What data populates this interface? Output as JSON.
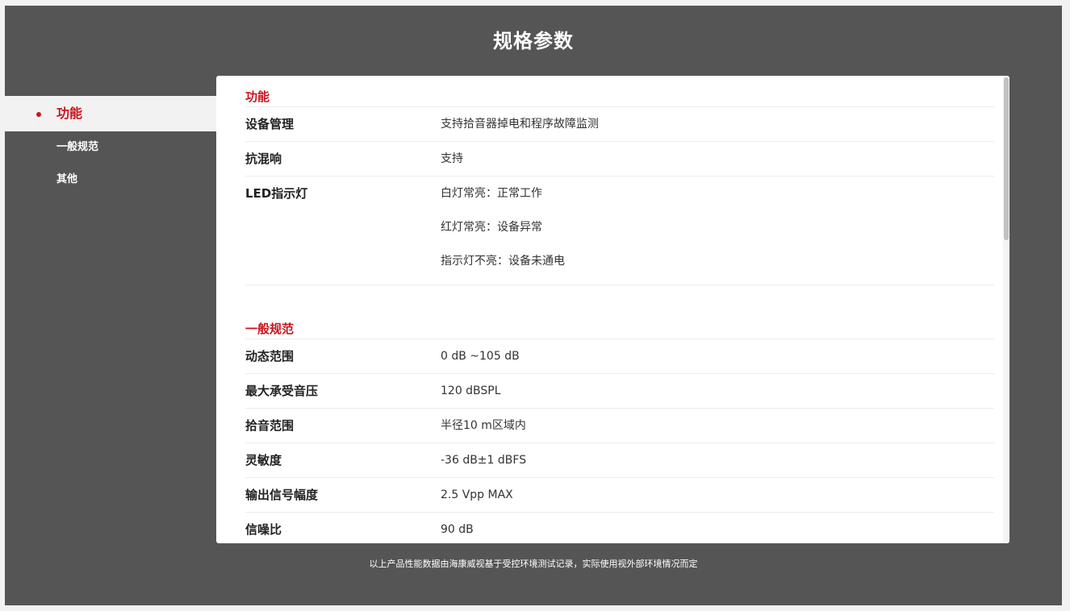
{
  "page_title": "规格参数",
  "sidebar": {
    "items": [
      {
        "label": "功能"
      },
      {
        "label": "一般规范"
      },
      {
        "label": "其他"
      }
    ]
  },
  "sections": [
    {
      "title": "功能",
      "rows": [
        {
          "key": "设备管理",
          "values": [
            "支持拾音器掉电和程序故障监测"
          ]
        },
        {
          "key": "抗混响",
          "values": [
            "支持"
          ]
        },
        {
          "key": "LED指示灯",
          "values": [
            "白灯常亮：正常工作",
            "红灯常亮：设备异常",
            "指示灯不亮：设备未通电"
          ]
        }
      ]
    },
    {
      "title": "一般规范",
      "rows": [
        {
          "key": "动态范围",
          "values": [
            "0 dB ~105 dB"
          ]
        },
        {
          "key": "最大承受音压",
          "values": [
            "120 dBSPL"
          ]
        },
        {
          "key": "拾音范围",
          "values": [
            "半径10 m区域内"
          ]
        },
        {
          "key": "灵敏度",
          "values": [
            "-36 dB±1 dBFS"
          ]
        },
        {
          "key": "输出信号幅度",
          "values": [
            "2.5 Vpp MAX"
          ]
        },
        {
          "key": "信噪比",
          "values": [
            "90 dB"
          ]
        }
      ]
    }
  ],
  "footer_note": "以上产品性能数据由海康威视基于受控环境测试记录，实际使用视外部环境情况而定",
  "colors": {
    "accent": "#c8161d",
    "background": "#555555",
    "panel": "#ffffff"
  }
}
